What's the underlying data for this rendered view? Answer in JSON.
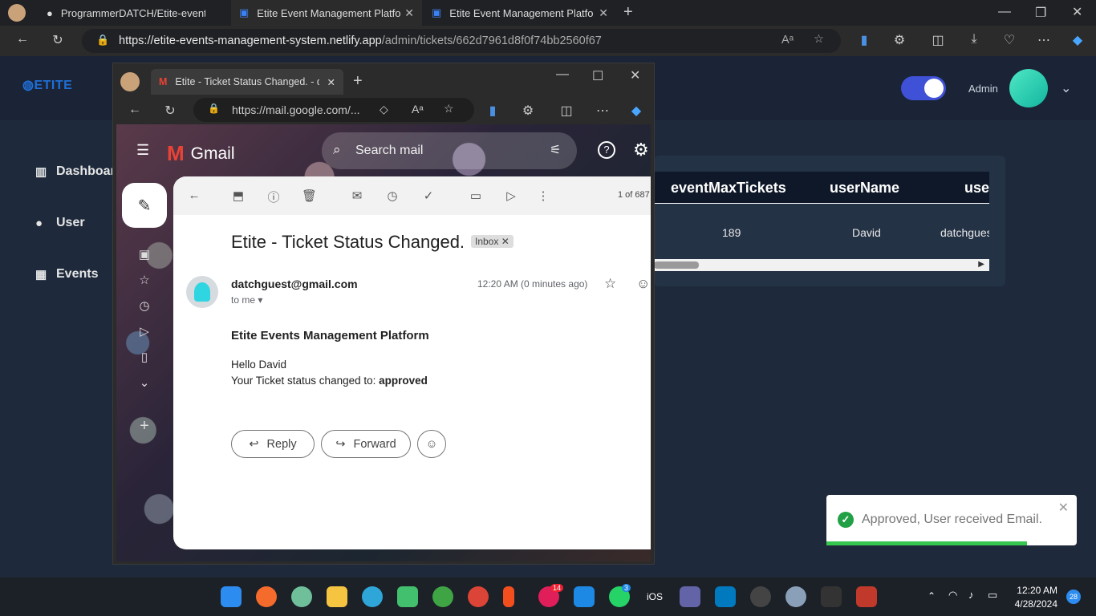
{
  "browser": {
    "tabs": [
      {
        "label": "ProgrammerDATCH/Etite-event-r"
      },
      {
        "label": "Etite Event Management Platform"
      },
      {
        "label": "Etite Event Management Platform"
      }
    ],
    "url_host": "https://etite-events-management-system.netlify.app",
    "url_path": "/admin/tickets/662d7961d8f0f74bb2560f67"
  },
  "app": {
    "logo": "ETITE",
    "sidebar": [
      {
        "label": "Dashboar",
        "icon": "bar-chart-icon"
      },
      {
        "label": "User",
        "icon": "user-icon"
      },
      {
        "label": "Events",
        "icon": "calendar-icon"
      }
    ],
    "header": {
      "user_label": "Admin"
    },
    "table": {
      "headers": [
        "eventMaxTickets",
        "userName",
        "use"
      ],
      "row": [
        "189",
        "David",
        "datchgues"
      ]
    }
  },
  "popup": {
    "tab_title": "Etite - Ticket Status Changed. - d",
    "url": "https://mail.google.com/...",
    "gmail": {
      "brand": "Gmail",
      "search_placeholder": "Search mail",
      "pager": "1 of 687",
      "subject": "Etite - Ticket Status Changed.",
      "label": "Inbox",
      "sender": "datchguest@gmail.com",
      "to": "to me",
      "time": "12:20 AM (0 minutes ago)",
      "body_title": "Etite Events Management Platform",
      "greeting": "Hello David",
      "status_prefix": "Your Ticket status changed to: ",
      "status_value": "approved",
      "reply": "Reply",
      "forward": "Forward"
    }
  },
  "toast": {
    "message": "Approved, User received Email.",
    "progress": 0.8
  },
  "taskbar": {
    "clock_time": "12:20 AM",
    "clock_date": "4/28/2024",
    "notif_count": "28",
    "slack_badge": "14",
    "whatsapp_badge": "3",
    "ios_label": "iOS"
  }
}
